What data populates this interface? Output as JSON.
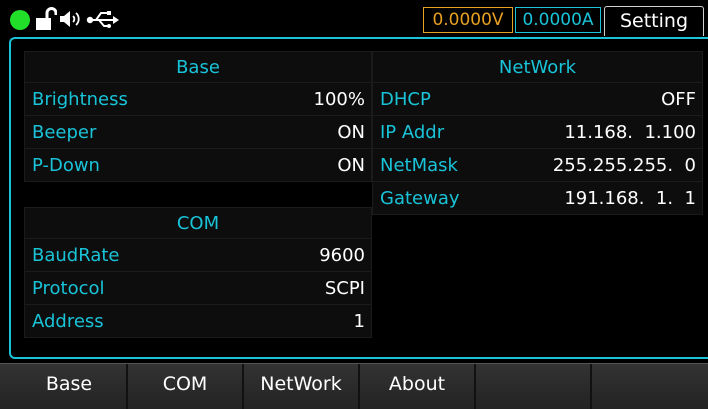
{
  "status": {
    "indicator_color": "#22e02a",
    "icons": [
      "unlock-icon",
      "speaker-icon",
      "usb-icon"
    ],
    "voltage": "0.0000V",
    "current": "0.0000A",
    "voltage_color": "#e8a023",
    "current_color": "#19c3d8",
    "active_tab": "Setting"
  },
  "base": {
    "title": "Base",
    "rows": [
      {
        "label": "Brightness",
        "value": "100%"
      },
      {
        "label": "Beeper",
        "value": "ON"
      },
      {
        "label": "P-Down",
        "value": "ON"
      }
    ]
  },
  "com": {
    "title": "COM",
    "rows": [
      {
        "label": "BaudRate",
        "value": "9600"
      },
      {
        "label": "Protocol",
        "value": "SCPI"
      },
      {
        "label": "Address",
        "value": "1"
      }
    ]
  },
  "network": {
    "title": "NetWork",
    "rows": [
      {
        "label": "DHCP",
        "value": "OFF"
      },
      {
        "label": "IP Addr",
        "value": "11.168.  1.100"
      },
      {
        "label": "NetMask",
        "value": "255.255.255.  0"
      },
      {
        "label": "Gateway",
        "value": "191.168.  1.  1"
      }
    ]
  },
  "menu": [
    "Base",
    "COM",
    "NetWork",
    "About",
    "",
    ""
  ],
  "accent_color": "#19c3d8"
}
